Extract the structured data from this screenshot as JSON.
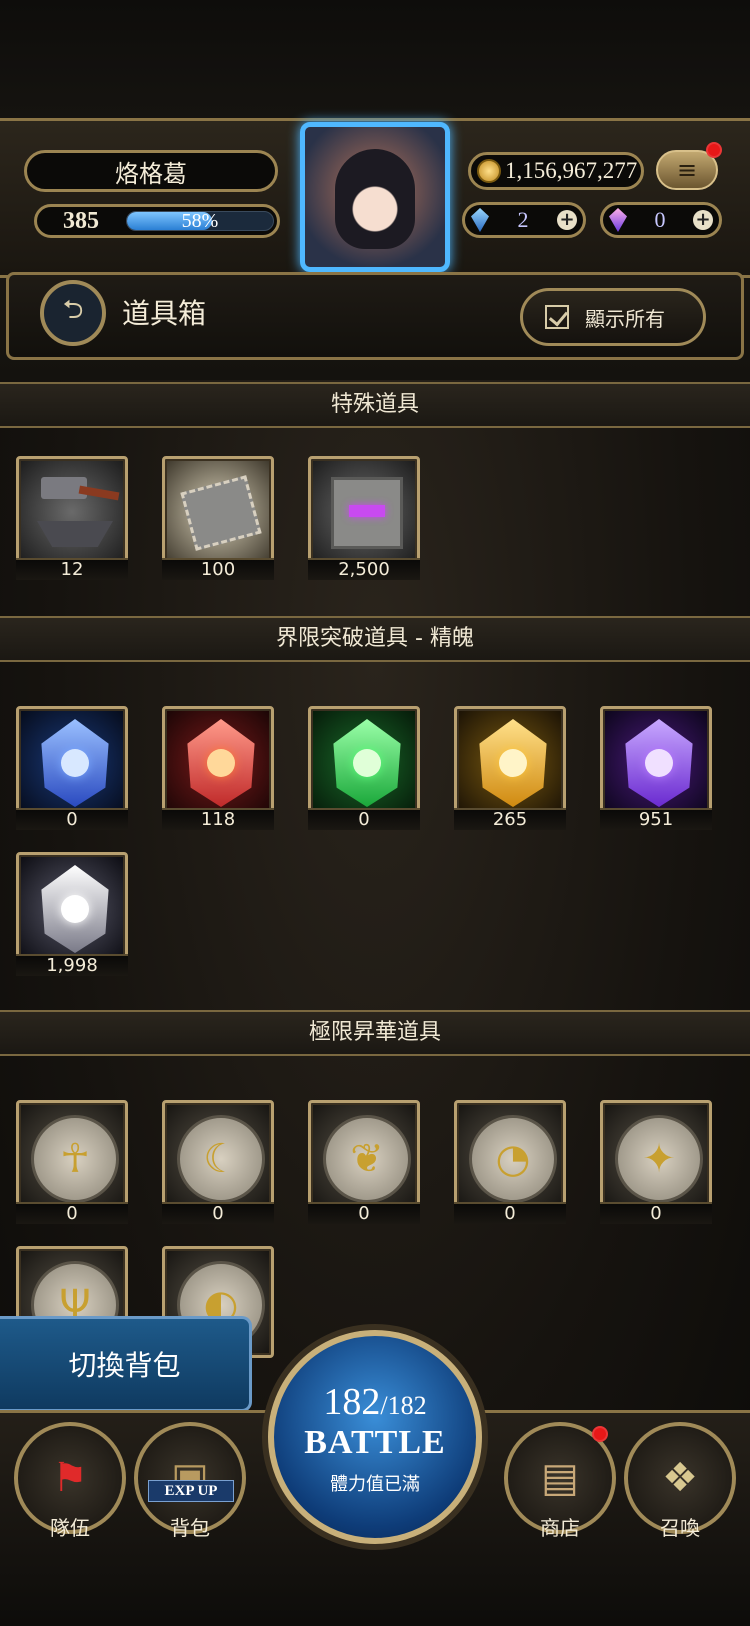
{
  "header": {
    "player_name": "烙格葛",
    "level": "385",
    "exp_percent": "58%",
    "exp_fraction": 0.58,
    "coins": "1,156,967,277",
    "gem_blue": "2",
    "gem_purple": "0",
    "menu_icon": "≡"
  },
  "title_bar": {
    "title": "道具箱",
    "show_all_label": "顯示所有"
  },
  "sections": [
    {
      "title": "特殊道具",
      "items": [
        {
          "name": "hammer-anvil",
          "count": "12"
        },
        {
          "name": "scroll-ticket",
          "count": "100"
        },
        {
          "name": "cube",
          "count": "2,500"
        }
      ]
    },
    {
      "title": "界限突破道具 - 精魄",
      "items": [
        {
          "name": "blue-stone",
          "count": "0",
          "color": "#3a6cf0"
        },
        {
          "name": "red-stone",
          "count": "118",
          "color": "#e83a2a"
        },
        {
          "name": "green-stone",
          "count": "0",
          "color": "#2ad84a"
        },
        {
          "name": "yellow-stone",
          "count": "265",
          "color": "#f0b020"
        },
        {
          "name": "purple-stone",
          "count": "951",
          "color": "#8a4af0"
        },
        {
          "name": "white-stone",
          "count": "1,998",
          "color": "#e8e8f0"
        }
      ]
    },
    {
      "title": "極限昇華道具",
      "items": [
        {
          "name": "medal-1",
          "count": "0",
          "symbol": "☥"
        },
        {
          "name": "medal-2",
          "count": "0",
          "symbol": "☾"
        },
        {
          "name": "medal-3",
          "count": "0",
          "symbol": "❦"
        },
        {
          "name": "medal-4",
          "count": "0",
          "symbol": "◔"
        },
        {
          "name": "medal-5",
          "count": "0",
          "symbol": "✦"
        },
        {
          "name": "medal-6",
          "count": "",
          "symbol": "Ψ"
        },
        {
          "name": "medal-7",
          "count": "",
          "symbol": "◐"
        }
      ]
    }
  ],
  "footer": {
    "switch_bag_label": "切換背包",
    "team_label": "隊伍",
    "bag_label": "背包",
    "exp_up_label": "EXP UP",
    "stamina_current": "182",
    "stamina_max": "/182",
    "battle_label": "BATTLE",
    "stamina_status": "體力值已滿",
    "shop_label": "商店",
    "summon_label": "召喚"
  }
}
